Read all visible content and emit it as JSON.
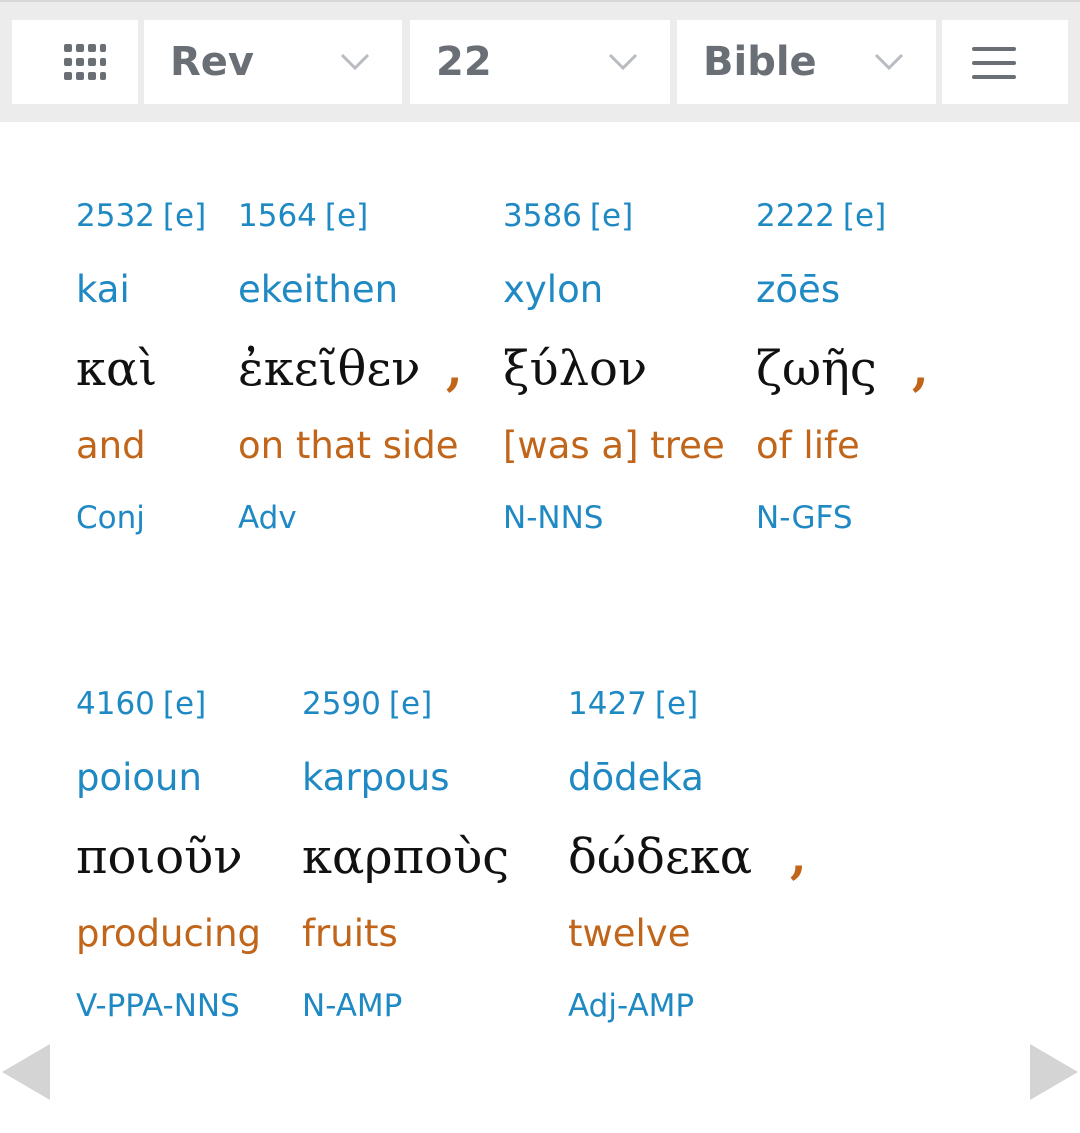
{
  "toolbar": {
    "book": "Rev",
    "chapter": "22",
    "version": "Bible"
  },
  "rows": [
    [
      {
        "strongs": "2532",
        "link": "[e]",
        "translit": "kai",
        "greek": "καὶ",
        "english": "and",
        "parsing": "Conj",
        "punct": ""
      },
      {
        "strongs": "1564",
        "link": "[e]",
        "translit": "ekeithen",
        "greek": "ἐκεῖθεν",
        "english": "on that side",
        "parsing": "Adv",
        "punct": ","
      },
      {
        "strongs": "3586",
        "link": "[e]",
        "translit": "xylon",
        "greek": "ξύλον",
        "english": "[was a] tree",
        "parsing": "N-NNS",
        "punct": ""
      },
      {
        "strongs": "2222",
        "link": "[e]",
        "translit": "zōēs",
        "greek": "ζωῆς",
        "english": "of life",
        "parsing": "N-GFS",
        "punct": ","
      }
    ],
    [
      {
        "strongs": "4160",
        "link": "[e]",
        "translit": "poioun",
        "greek": "ποιοῦν",
        "english": "producing",
        "parsing": "V-PPA-NNS",
        "punct": ""
      },
      {
        "strongs": "2590",
        "link": "[e]",
        "translit": "karpous",
        "greek": "καρποὺς",
        "english": "fruits",
        "parsing": "N-AMP",
        "punct": ""
      },
      {
        "strongs": "1427",
        "link": "[e]",
        "translit": "dōdeka",
        "greek": "δώδεκα",
        "english": "twelve",
        "parsing": "Adj-AMP",
        "punct": ","
      }
    ]
  ],
  "icons": {
    "grid": "apps-grid-icon",
    "menu": "hamburger-menu-icon",
    "prev": "previous-arrow-icon",
    "next": "next-arrow-icon"
  },
  "colors": {
    "blue": "#1f89c4",
    "orange": "#c0651a",
    "greek": "#111111",
    "toolbar_text": "#6a6f75"
  }
}
